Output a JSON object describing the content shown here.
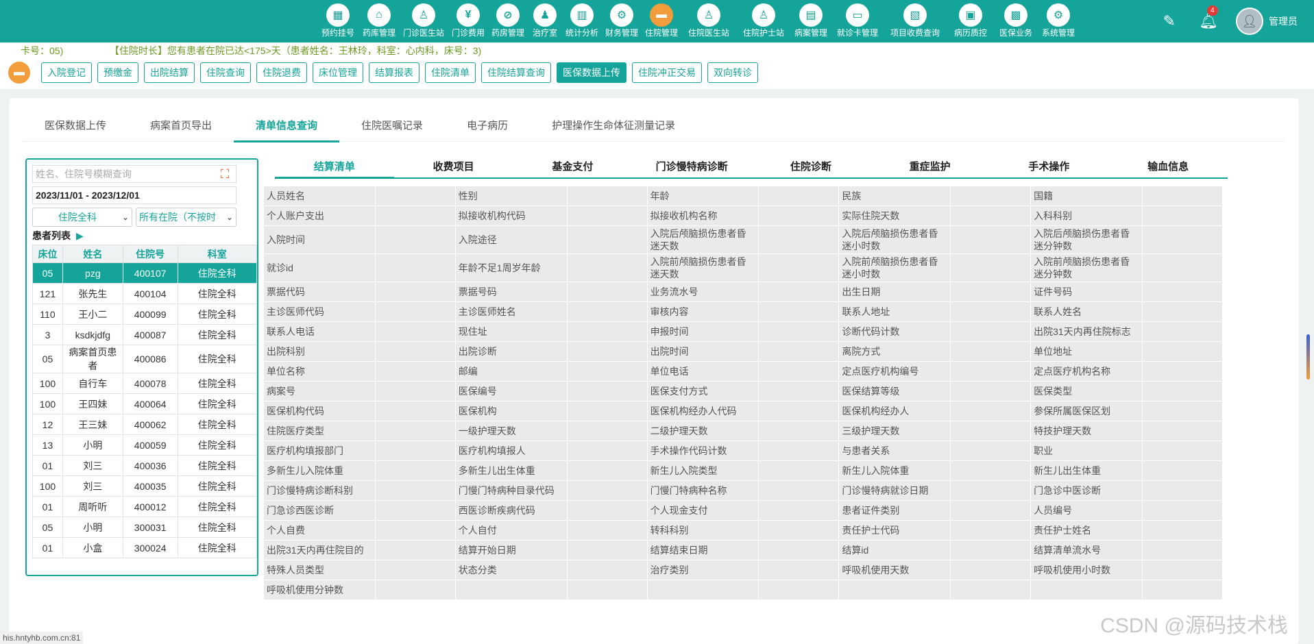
{
  "nav": [
    {
      "label": "预约挂号",
      "glyph": "▦",
      "active": false
    },
    {
      "label": "药库管理",
      "glyph": "⌂",
      "active": false
    },
    {
      "label": "门诊医生站",
      "glyph": "♙",
      "active": false
    },
    {
      "label": "门诊费用",
      "glyph": "¥",
      "active": false
    },
    {
      "label": "药房管理",
      "glyph": "⊘",
      "active": false
    },
    {
      "label": "治疗室",
      "glyph": "♟",
      "active": false
    },
    {
      "label": "统计分析",
      "glyph": "▥",
      "active": false
    },
    {
      "label": "财务管理",
      "glyph": "⚙",
      "active": false
    },
    {
      "label": "住院管理",
      "glyph": "▬",
      "active": true
    },
    {
      "label": "住院医生站",
      "glyph": "♙",
      "active": false
    },
    {
      "label": "住院护士站",
      "glyph": "♙",
      "active": false
    },
    {
      "label": "病案管理",
      "glyph": "▤",
      "active": false
    },
    {
      "label": "就诊卡管理",
      "glyph": "▭",
      "active": false
    },
    {
      "label": "项目收费查询",
      "glyph": "▧",
      "active": false
    },
    {
      "label": "病历质控",
      "glyph": "▣",
      "active": false
    },
    {
      "label": "医保业务",
      "glyph": "▩",
      "active": false
    },
    {
      "label": "系统管理",
      "glyph": "⚙",
      "active": false
    }
  ],
  "user": {
    "name": "管理员",
    "notifications": "4"
  },
  "notice": {
    "part1": "卡号：05)",
    "part2": "【住院时长】您有患者在院已达<175>天（患者姓名：王林玲，科室：心内科，床号：3)"
  },
  "actions": [
    {
      "label": "入院登记",
      "active": false
    },
    {
      "label": "预缴金",
      "active": false
    },
    {
      "label": "出院结算",
      "active": false
    },
    {
      "label": "住院查询",
      "active": false
    },
    {
      "label": "住院退费",
      "active": false
    },
    {
      "label": "床位管理",
      "active": false
    },
    {
      "label": "结算报表",
      "active": false
    },
    {
      "label": "住院清单",
      "active": false
    },
    {
      "label": "住院结算查询",
      "active": false
    },
    {
      "label": "医保数据上传",
      "active": true
    },
    {
      "label": "住院冲正交易",
      "active": false
    },
    {
      "label": "双向转诊",
      "active": false
    }
  ],
  "tabs": [
    {
      "label": "医保数据上传",
      "active": false
    },
    {
      "label": "病案首页导出",
      "active": false
    },
    {
      "label": "清单信息查询",
      "active": true
    },
    {
      "label": "住院医嘱记录",
      "active": false
    },
    {
      "label": "电子病历",
      "active": false
    },
    {
      "label": "护理操作生命体征测量记录",
      "active": false
    }
  ],
  "search": {
    "placeholder": "姓名、住院号模糊查询",
    "value": ""
  },
  "date_range": "2023/11/01 - 2023/12/01",
  "dept_select": "住院全科",
  "status_select": "所有在院（不按时",
  "patient_list_title": "患者列表",
  "patient_columns": [
    "床位",
    "姓名",
    "住院号",
    "科室"
  ],
  "patients": [
    [
      "05",
      "pzg",
      "400107",
      "住院全科"
    ],
    [
      "121",
      "张先生",
      "400104",
      "住院全科"
    ],
    [
      "110",
      "王小二",
      "400099",
      "住院全科"
    ],
    [
      "3",
      "ksdkjdfg",
      "400087",
      "住院全科"
    ],
    [
      "05",
      "病案首页患者",
      "400086",
      "住院全科"
    ],
    [
      "100",
      "自行车",
      "400078",
      "住院全科"
    ],
    [
      "100",
      "王四妹",
      "400064",
      "住院全科"
    ],
    [
      "12",
      "王三妹",
      "400062",
      "住院全科"
    ],
    [
      "13",
      "小明",
      "400059",
      "住院全科"
    ],
    [
      "01",
      "刘三",
      "400036",
      "住院全科"
    ],
    [
      "100",
      "刘三",
      "400035",
      "住院全科"
    ],
    [
      "01",
      "周听听",
      "400012",
      "住院全科"
    ],
    [
      "05",
      "小明",
      "300031",
      "住院全科"
    ],
    [
      "01",
      "小盒",
      "300024",
      "住院全科"
    ]
  ],
  "selected_patient_index": 0,
  "subtabs": [
    {
      "label": "结算清单",
      "active": true
    },
    {
      "label": "收费项目",
      "active": false
    },
    {
      "label": "基金支付",
      "active": false
    },
    {
      "label": "门诊慢特病诊断",
      "active": false
    },
    {
      "label": "住院诊断",
      "active": false
    },
    {
      "label": "重症监护",
      "active": false
    },
    {
      "label": "手术操作",
      "active": false
    },
    {
      "label": "输血信息",
      "active": false
    }
  ],
  "grid_rows": [
    [
      "人员姓名",
      "性别",
      "年龄",
      "民族",
      "国籍"
    ],
    [
      "个人账户支出",
      "拟接收机构代码",
      "拟接收机构名称",
      "实际住院天数",
      "入科科别"
    ],
    [
      "入院时间",
      "入院途径",
      "入院后颅脑损伤患者昏迷天数",
      "入院后颅脑损伤患者昏迷小时数",
      "入院后颅脑损伤患者昏迷分钟数"
    ],
    [
      "就诊id",
      "年龄不足1周岁年龄",
      "入院前颅脑损伤患者昏迷天数",
      "入院前颅脑损伤患者昏迷小时数",
      "入院前颅脑损伤患者昏迷分钟数"
    ],
    [
      "票据代码",
      "票据号码",
      "业务流水号",
      "出生日期",
      "证件号码"
    ],
    [
      "主诊医师代码",
      "主诊医师姓名",
      "审核内容",
      "联系人地址",
      "联系人姓名"
    ],
    [
      "联系人电话",
      "现住址",
      "申报时间",
      "诊断代码计数",
      "出院31天内再住院标志"
    ],
    [
      "出院科别",
      "出院诊断",
      "出院时间",
      "离院方式",
      "单位地址"
    ],
    [
      "单位名称",
      "邮编",
      "单位电话",
      "定点医疗机构编号",
      "定点医疗机构名称"
    ],
    [
      "病案号",
      "医保编号",
      "医保支付方式",
      "医保结算等级",
      "医保类型"
    ],
    [
      "医保机构代码",
      "医保机构",
      "医保机构经办人代码",
      "医保机构经办人",
      "参保所属医保区划"
    ],
    [
      "住院医疗类型",
      "一级护理天数",
      "二级护理天数",
      "三级护理天数",
      "特技护理天数"
    ],
    [
      "医疗机构填报部门",
      "医疗机构填报人",
      "手术操作代码计数",
      "与患者关系",
      "职业"
    ],
    [
      "多新生儿入院体重",
      "多新生儿出生体重",
      "新生儿入院类型",
      "新生儿入院体重",
      "新生儿出生体重"
    ],
    [
      "门诊慢特病诊断科别",
      "门慢门特病种目录代码",
      "门慢门特病种名称",
      "门诊慢特病就诊日期",
      "门急诊中医诊断"
    ],
    [
      "门急诊西医诊断",
      "西医诊断疾病代码",
      "个人现金支付",
      "患者证件类别",
      "人员编号"
    ],
    [
      "个人自费",
      "个人自付",
      "转科科别",
      "责任护士代码",
      "责任护士姓名"
    ],
    [
      "出院31天内再住院目的",
      "结算开始日期",
      "结算结束日期",
      "结算id",
      "结算清单流水号"
    ],
    [
      "特殊人员类型",
      "状态分类",
      "治疗类别",
      "呼吸机使用天数",
      "呼吸机使用小时数"
    ],
    [
      "呼吸机使用分钟数",
      "",
      "",
      "",
      ""
    ]
  ],
  "status_url": "his.hntyhb.com.cn:81",
  "watermark": "CSDN @源码技术栈"
}
